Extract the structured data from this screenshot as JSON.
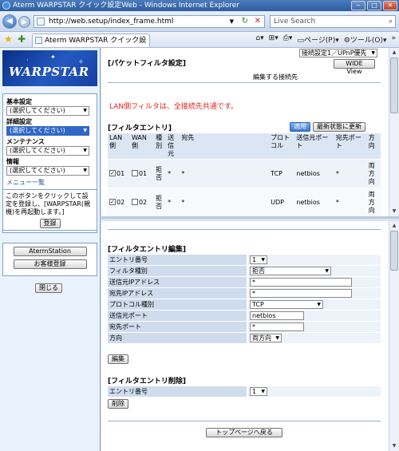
{
  "window": {
    "title": "Aterm WARPSTAR クイック設定Web - Windows Internet Explorer"
  },
  "browser": {
    "url": "http://web.setup/index_frame.html",
    "search_placeholder": "Live Search",
    "tab_title": "Aterm WARPSTAR クイック設定Web",
    "page_menu": "ページ(P)",
    "tools_menu": "ツール(O)"
  },
  "sidebar": {
    "logo": "WARPSTAR",
    "groups": [
      {
        "label": "基本設定",
        "value": "(選択してください)"
      },
      {
        "label": "詳細設定",
        "value": "(選択してください)"
      },
      {
        "label": "メンテナンス",
        "value": "(選択してください)"
      },
      {
        "label": "情報",
        "value": "(選択してください)"
      }
    ],
    "menu_link": "メニュー一覧",
    "register_note": "このボタンをクリックして設定を登録し、[WARPSTAR(親機)を再起動します。]",
    "register_button": "登録",
    "aterm_station_button": "AtermStation",
    "customer_register_button": "お客様登録",
    "close_button": "閉じる"
  },
  "top": {
    "heading": "[パケットフィルタ設定]",
    "wide_view_button": "WIDE View",
    "connection_label": "編集する接続先",
    "connection_value": "接続設定1／UPnP優先",
    "warning": "LAN側フィルタは、全接続先共通です。",
    "entries_heading": "[フィルタエントリ]",
    "apply_button": "適用",
    "refresh_button": "最新状態に更新",
    "columns": [
      "LAN側",
      "WAN側",
      "種別",
      "送信元",
      "宛先",
      "プロトコル",
      "送信元ポート",
      "宛先ポート",
      "方向"
    ],
    "rows": [
      {
        "lan": "01",
        "lan_checked": true,
        "wan": "01",
        "wan_checked": false,
        "type": "拒否",
        "src": "*",
        "dst": "*",
        "proto": "TCP",
        "src_port": "netbios",
        "dst_port": "*",
        "dir": "両方向"
      },
      {
        "lan": "02",
        "lan_checked": true,
        "wan": "02",
        "wan_checked": false,
        "type": "拒否",
        "src": "*",
        "dst": "*",
        "proto": "UDP",
        "src_port": "netbios",
        "dst_port": "*",
        "dir": "両方向"
      }
    ]
  },
  "edit": {
    "heading": "[フィルタエントリ編集]",
    "fields": {
      "entry_no": {
        "label": "エントリ番号",
        "value": "1"
      },
      "filter_type": {
        "label": "フィルタ種別",
        "value": "拒否"
      },
      "src_ip": {
        "label": "送信元IPアドレス",
        "value": "*"
      },
      "dst_ip": {
        "label": "宛先IPアドレス",
        "value": "*"
      },
      "protocol": {
        "label": "プロトコル種別",
        "value": "TCP"
      },
      "src_port": {
        "label": "送信元ポート",
        "value": "netbios"
      },
      "dst_port": {
        "label": "宛先ポート",
        "value": "*"
      },
      "direction": {
        "label": "方向",
        "value": "両方向"
      }
    },
    "edit_button": "編集"
  },
  "delete": {
    "heading": "[フィルタエントリ削除]",
    "entry_label": "エントリ番号",
    "entry_value": "1",
    "delete_button": "削除"
  },
  "back_to_top_button": "トップページへ戻る"
}
